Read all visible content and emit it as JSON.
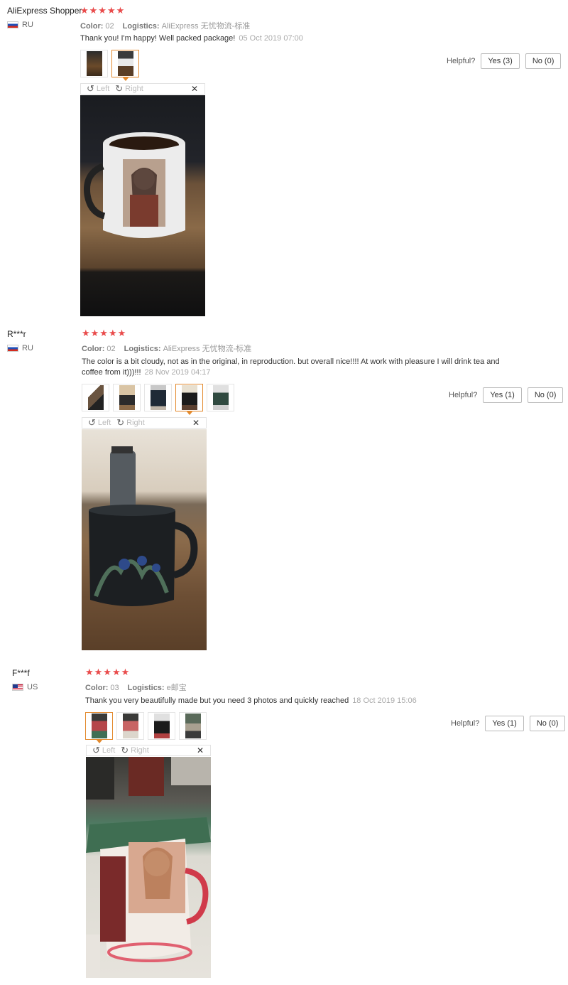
{
  "labels": {
    "color": "Color:",
    "logistics": "Logistics:",
    "helpful": "Helpful?",
    "left": "Left",
    "right": "Right"
  },
  "reviews": [
    {
      "user": "AliExpress Shopper",
      "country": "RU",
      "stars": "★★★★★",
      "color": "02",
      "logistics": "AliExpress 无忧物流-标准",
      "text": "Thank you! I'm happy! Well packed package!",
      "date": "05 Oct 2019 07:00",
      "yes": "Yes (3)",
      "no": "No (0)"
    },
    {
      "user": "R***r",
      "country": "RU",
      "stars": "★★★★★",
      "color": "02",
      "logistics": "AliExpress 无忧物流-标准",
      "text": "The color is a bit cloudy, not as in the original, in reproduction. but overall nice!!!! At work with pleasure I will drink tea and coffee from it)))!!!",
      "date": "28 Nov 2019 04:17",
      "yes": "Yes (1)",
      "no": "No (0)"
    },
    {
      "user": "F***f",
      "country": "US",
      "stars": "★★★★★",
      "color": "03",
      "logistics": "e邮宝",
      "text": "Thank you very beautifully made but you need 3 photos and quickly reached",
      "date": "18 Oct 2019 15:06",
      "yes": "Yes (1)",
      "no": "No (0)"
    }
  ]
}
